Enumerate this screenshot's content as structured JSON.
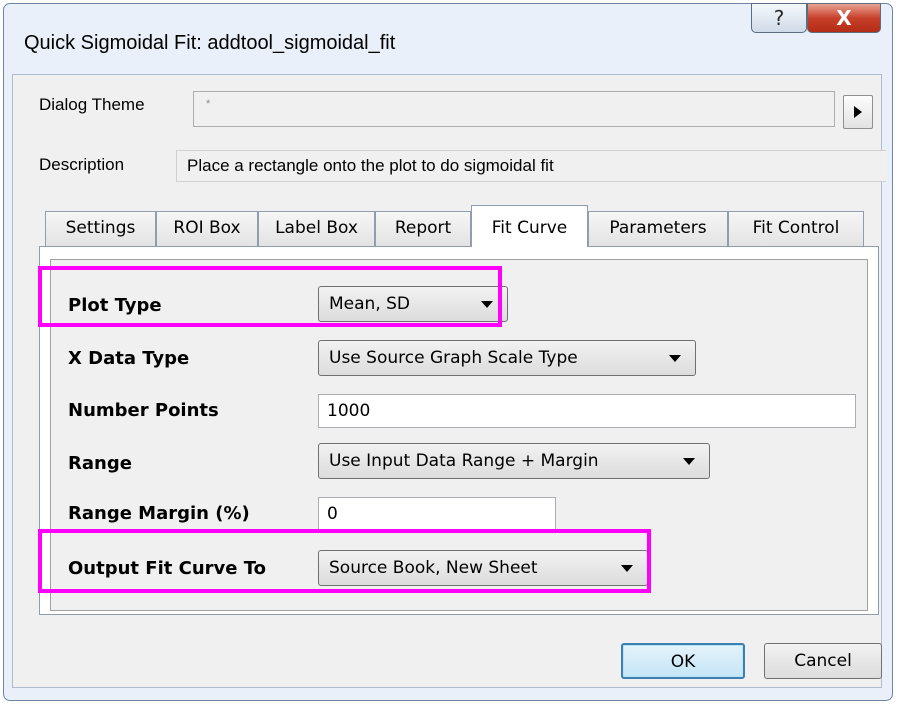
{
  "window": {
    "title": "Quick Sigmoidal Fit: addtool_sigmoidal_fit",
    "help_icon": "question-mark",
    "close_icon": "x-close",
    "help_symbol": "?",
    "close_symbol": "X"
  },
  "dialog_theme": {
    "label": "Dialog Theme",
    "value": "*",
    "menu_icon": "triangle-right"
  },
  "description": {
    "label": "Description",
    "value": "Place a rectangle onto the plot to do sigmoidal fit"
  },
  "tabs": [
    {
      "label": "Settings",
      "active": false
    },
    {
      "label": "ROI Box",
      "active": false
    },
    {
      "label": "Label Box",
      "active": false
    },
    {
      "label": "Report",
      "active": false
    },
    {
      "label": "Fit Curve",
      "active": true
    },
    {
      "label": "Parameters",
      "active": false
    },
    {
      "label": "Fit Control",
      "active": false
    }
  ],
  "fit_curve": {
    "plot_type": {
      "label": "Plot Type",
      "value": "Mean, SD"
    },
    "x_data_type": {
      "label": "X Data Type",
      "value": "Use Source Graph Scale Type"
    },
    "number_points": {
      "label": "Number Points",
      "value": "1000"
    },
    "range": {
      "label": "Range",
      "value": "Use Input Data Range + Margin"
    },
    "range_margin": {
      "label": "Range Margin (%)",
      "value": "0"
    },
    "output_fit_curve_to": {
      "label": "Output Fit Curve To",
      "value": "Source Book, New Sheet"
    }
  },
  "buttons": {
    "ok": "OK",
    "cancel": "Cancel"
  },
  "colors": {
    "highlight": "#ff00ff",
    "window_frame": "#e9f0f9",
    "close_button": "#c7402a"
  }
}
